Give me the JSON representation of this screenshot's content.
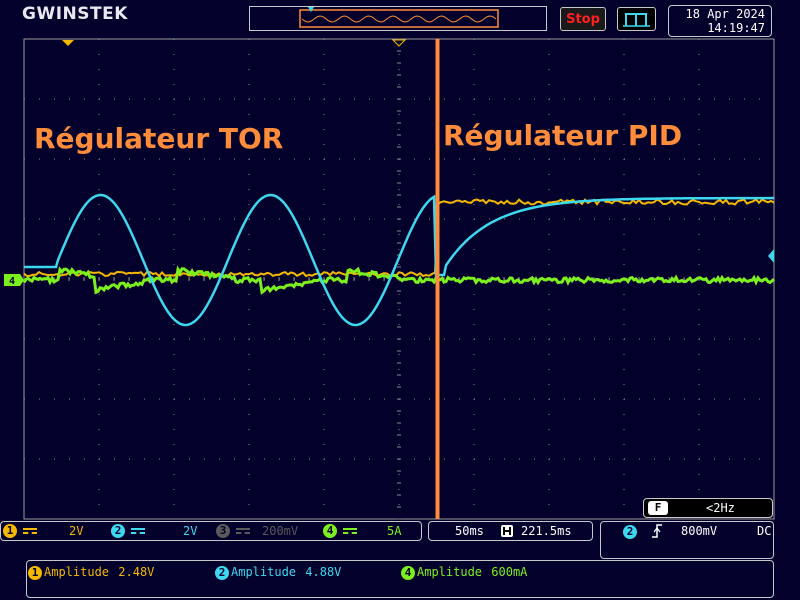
{
  "header": {
    "brand": "GWINSTEK",
    "run_state": "Stop",
    "date": "18 Apr 2024",
    "time": "14:19:47"
  },
  "annotations": {
    "left_label": "Régulateur TOR",
    "right_label": "Régulateur PID"
  },
  "channels": [
    {
      "number": "1",
      "scale": "2V",
      "color": "#f5b800",
      "active": true
    },
    {
      "number": "2",
      "scale": "2V",
      "color": "#3cd8f0",
      "active": true
    },
    {
      "number": "3",
      "scale": "200mV",
      "color": "#5a5a5a",
      "active": false
    },
    {
      "number": "4",
      "scale": "5A",
      "color": "#7cf01e",
      "active": true
    }
  ],
  "ground_marker": "4",
  "timebase": {
    "div": "50ms",
    "position": "221.5ms"
  },
  "trigger": {
    "source": "2",
    "level": "800mV",
    "coupling": "DC"
  },
  "frequency": {
    "label": "F",
    "value": "<2Hz"
  },
  "measurements": [
    {
      "channel": "1",
      "label": "Amplitude",
      "value": "2.48V",
      "color": "#f5b800"
    },
    {
      "channel": "2",
      "label": "Amplitude",
      "value": "4.88V",
      "color": "#3cd8f0"
    },
    {
      "channel": "4",
      "label": "Amplitude",
      "value": "600mA",
      "color": "#7cf01e"
    }
  ]
}
